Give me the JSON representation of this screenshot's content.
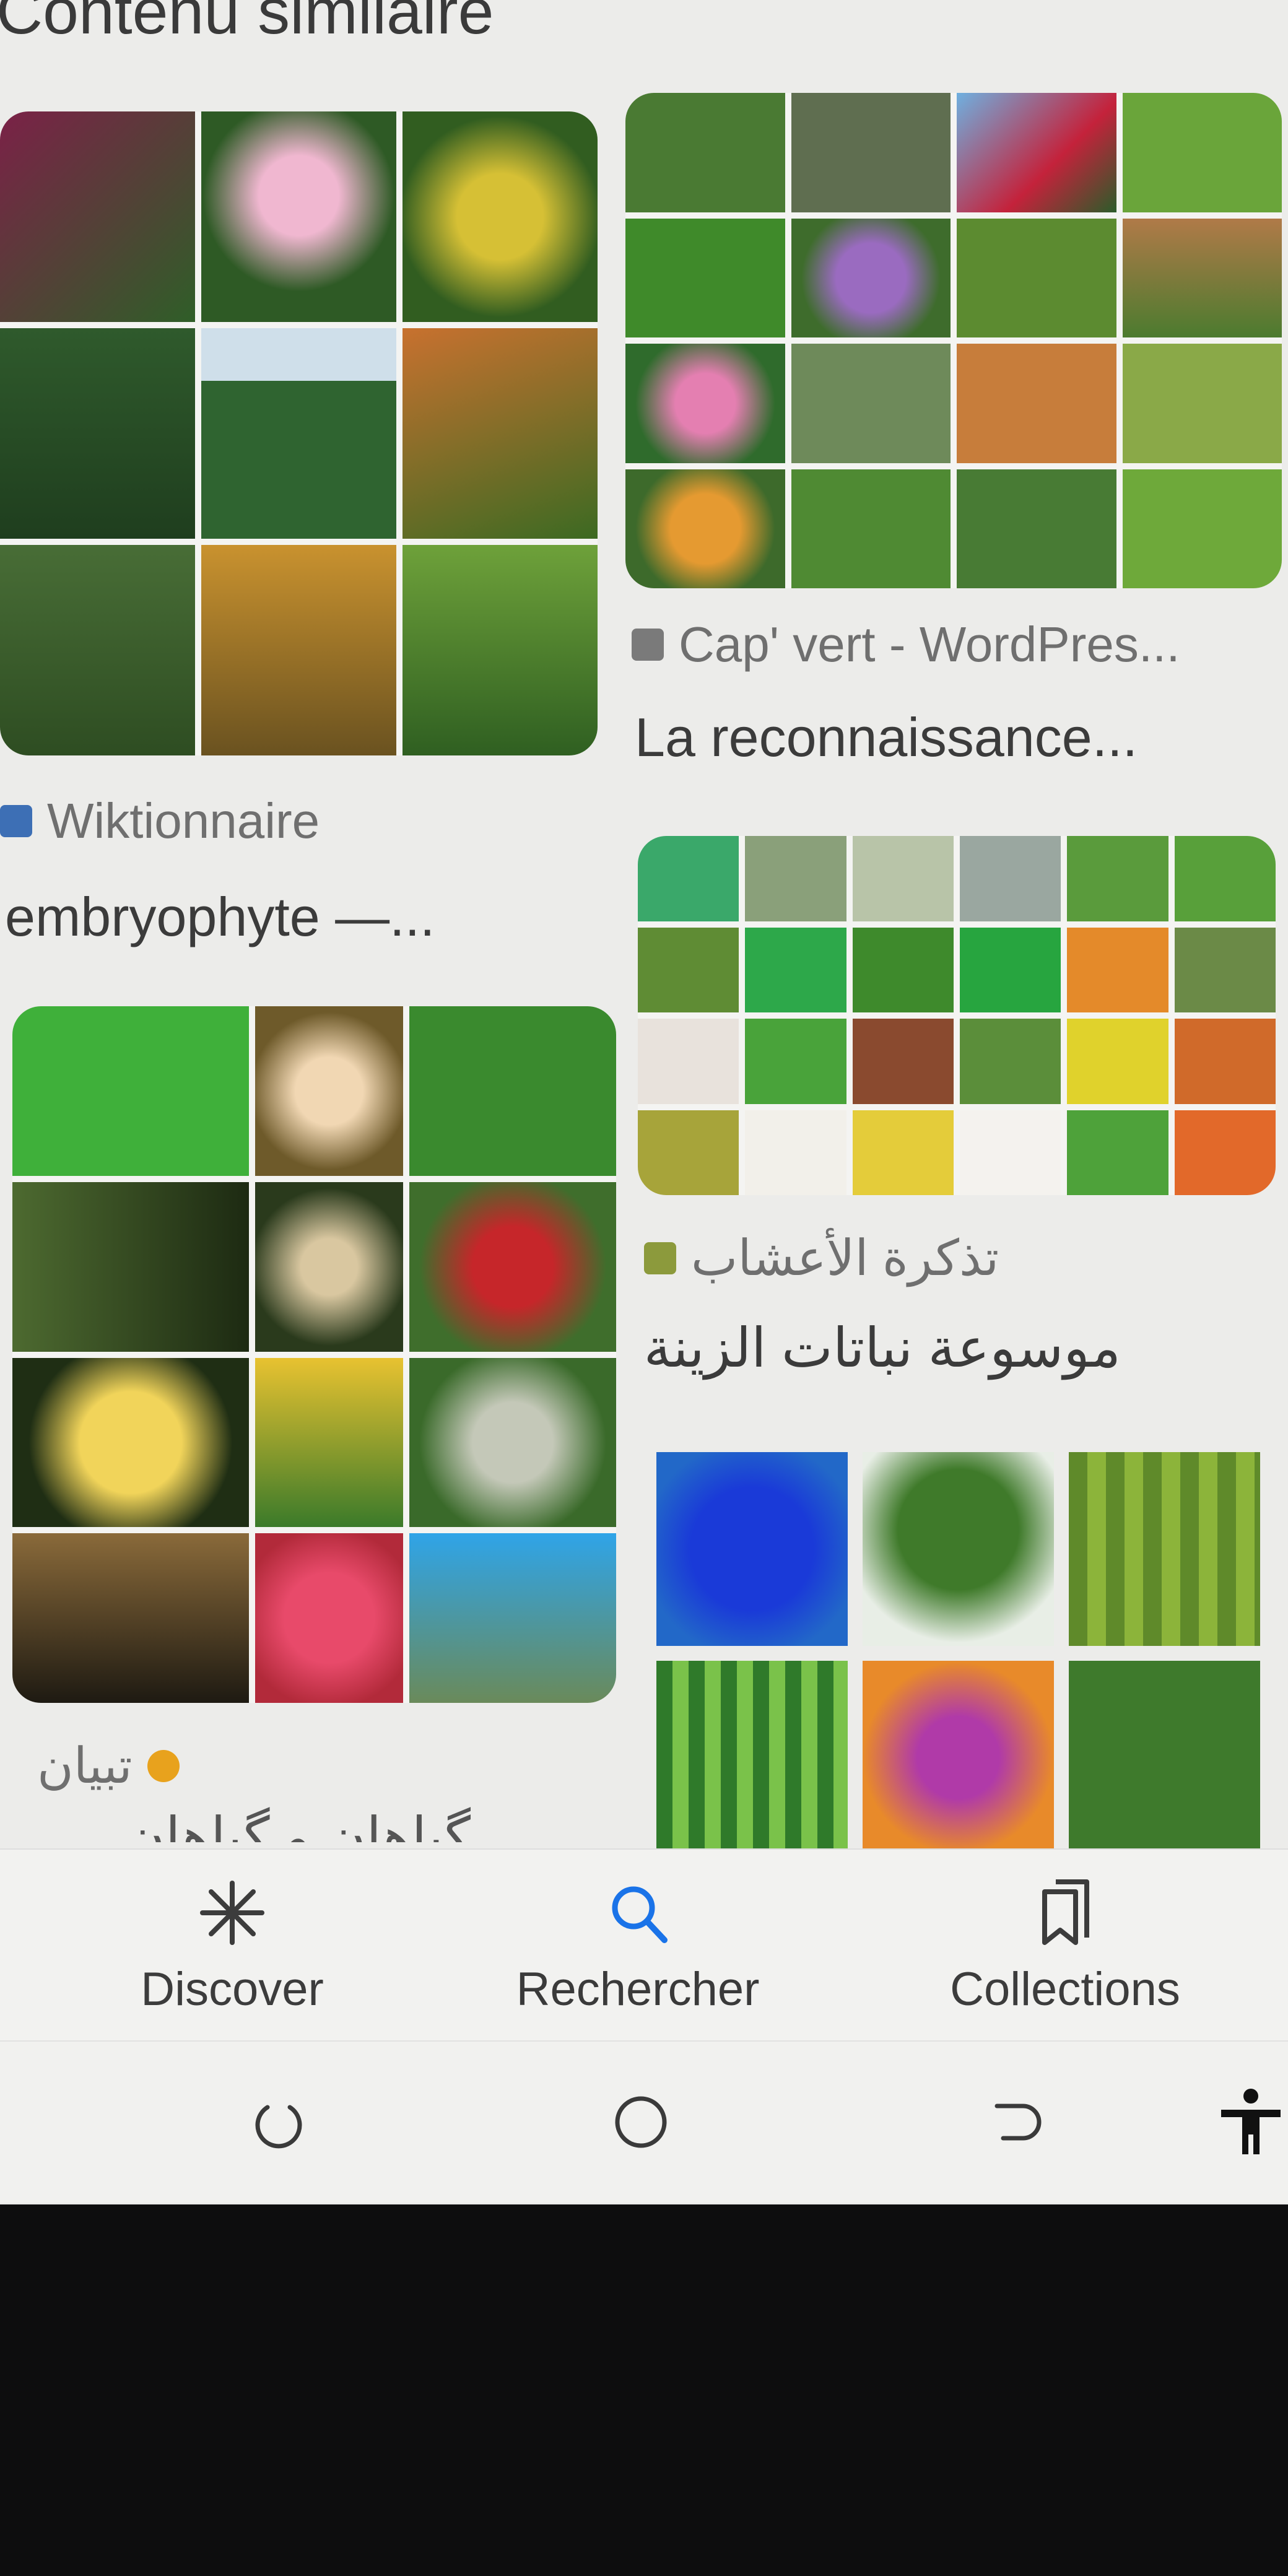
{
  "section_title": "Contenu similaire",
  "cards": [
    {
      "source_name": "Wiktionnaire",
      "caption": "embryophyte —...",
      "favicon_color": "#3d6fb5"
    },
    {
      "source_name": "Cap' vert - WordPres...",
      "caption": "La reconnaissance...",
      "favicon_color": "#7a7a7a"
    },
    {
      "source_name": "تذكرة الأعشاب",
      "caption": "موسوعة نباتات الزينة",
      "favicon_color": "#8c9a3c"
    },
    {
      "source_name": "تبيان",
      "caption": "گیاهان و گیاهان",
      "favicon_color": "#e8a21d"
    }
  ],
  "bottom_nav": {
    "items": [
      {
        "label": "Discover",
        "icon": "asterisk-icon"
      },
      {
        "label": "Rechercher",
        "icon": "search-icon",
        "active": true
      },
      {
        "label": "Collections",
        "icon": "bookmark-stack-icon"
      }
    ]
  },
  "system_nav": {
    "buttons": [
      "recent-apps-icon",
      "home-icon",
      "back-icon",
      "accessibility-icon"
    ]
  },
  "colors": {
    "background": "#ececea",
    "accent": "#1a73e8",
    "text": "#3b3b3b"
  }
}
